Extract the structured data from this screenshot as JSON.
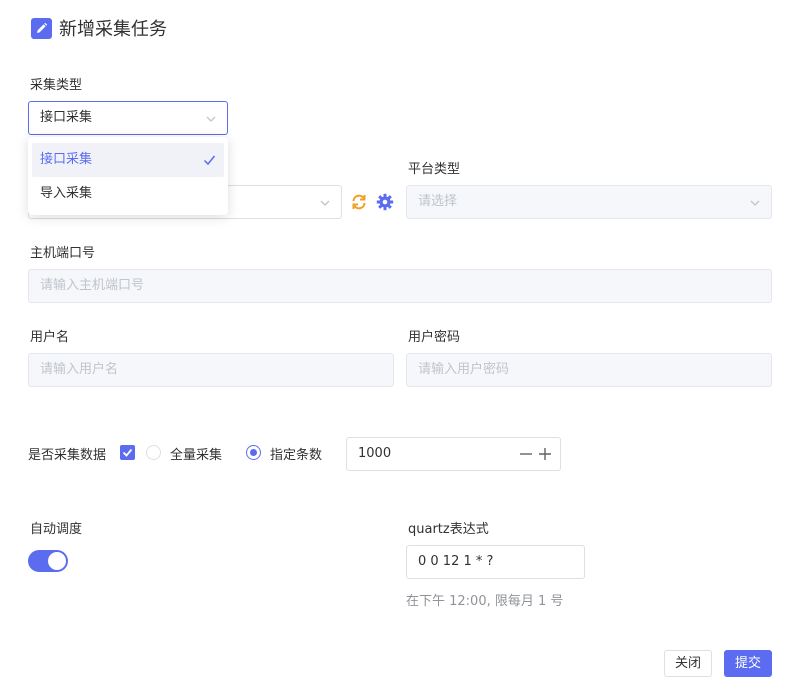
{
  "dialog": {
    "title": "新增采集任务"
  },
  "collect_type": {
    "label": "采集类型",
    "value": "接口采集",
    "options": [
      {
        "label": "接口采集",
        "selected": true
      },
      {
        "label": "导入采集",
        "selected": false
      }
    ]
  },
  "platform_type": {
    "label": "平台类型",
    "placeholder": "请选择"
  },
  "host_port": {
    "label": "主机端口号",
    "placeholder": "请输入主机端口号"
  },
  "username": {
    "label": "用户名",
    "placeholder": "请输入用户名"
  },
  "password": {
    "label": "用户密码",
    "placeholder": "请输入用户密码"
  },
  "collect_data": {
    "label": "是否采集数据",
    "checked": true,
    "options": [
      {
        "label": "全量采集",
        "selected": false
      },
      {
        "label": "指定条数",
        "selected": true
      }
    ],
    "count": "1000"
  },
  "auto_schedule": {
    "label": "自动调度",
    "enabled": true
  },
  "quartz": {
    "label": "quartz表达式",
    "value": "0 0 12 1 * ?",
    "hint": "在下午 12:00, 限每月 1 号"
  },
  "footer": {
    "close_label": "关闭",
    "submit_label": "提交"
  },
  "colors": {
    "primary": "#5b6cf0",
    "refresh_icon": "#f0a020"
  }
}
